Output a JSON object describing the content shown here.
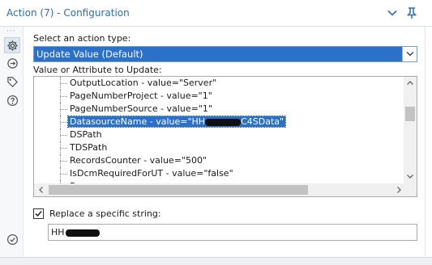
{
  "window": {
    "title": "Action (7) - Configuration",
    "icons": [
      "chevron-down-icon",
      "pin-icon"
    ]
  },
  "rail": {
    "items": [
      {
        "name": "gear-icon",
        "active": true
      },
      {
        "name": "connection-icon",
        "active": false
      },
      {
        "name": "tag-icon",
        "active": false
      },
      {
        "name": "help-icon",
        "active": false
      },
      {
        "name": "check-circle-icon",
        "active": false
      }
    ]
  },
  "action_type": {
    "label": "Select an action type:",
    "selected": "Update Value (Default)"
  },
  "tree": {
    "label": "Value or Attribute to Update:",
    "items": [
      {
        "text": "OutputLocation - value=\"Server\""
      },
      {
        "text": "PageNumberProject - value=\"1\""
      },
      {
        "text": "PageNumberSource - value=\"1\""
      },
      {
        "text_before": "DatasourceName - value=\"HH",
        "text_after": "C4SData\"",
        "selected": true
      },
      {
        "text": "DSPath"
      },
      {
        "text": "TDSPath"
      },
      {
        "text": "RecordsCounter - value=\"500\""
      },
      {
        "text": "IsDcmRequiredForUT - value=\"false\""
      },
      {
        "text": "F"
      }
    ]
  },
  "replace": {
    "checkbox_label": "Replace a specific string:",
    "checked": true,
    "value_prefix": "HH"
  },
  "colors": {
    "accent": "#2b70c9",
    "title": "#2f6db5"
  }
}
